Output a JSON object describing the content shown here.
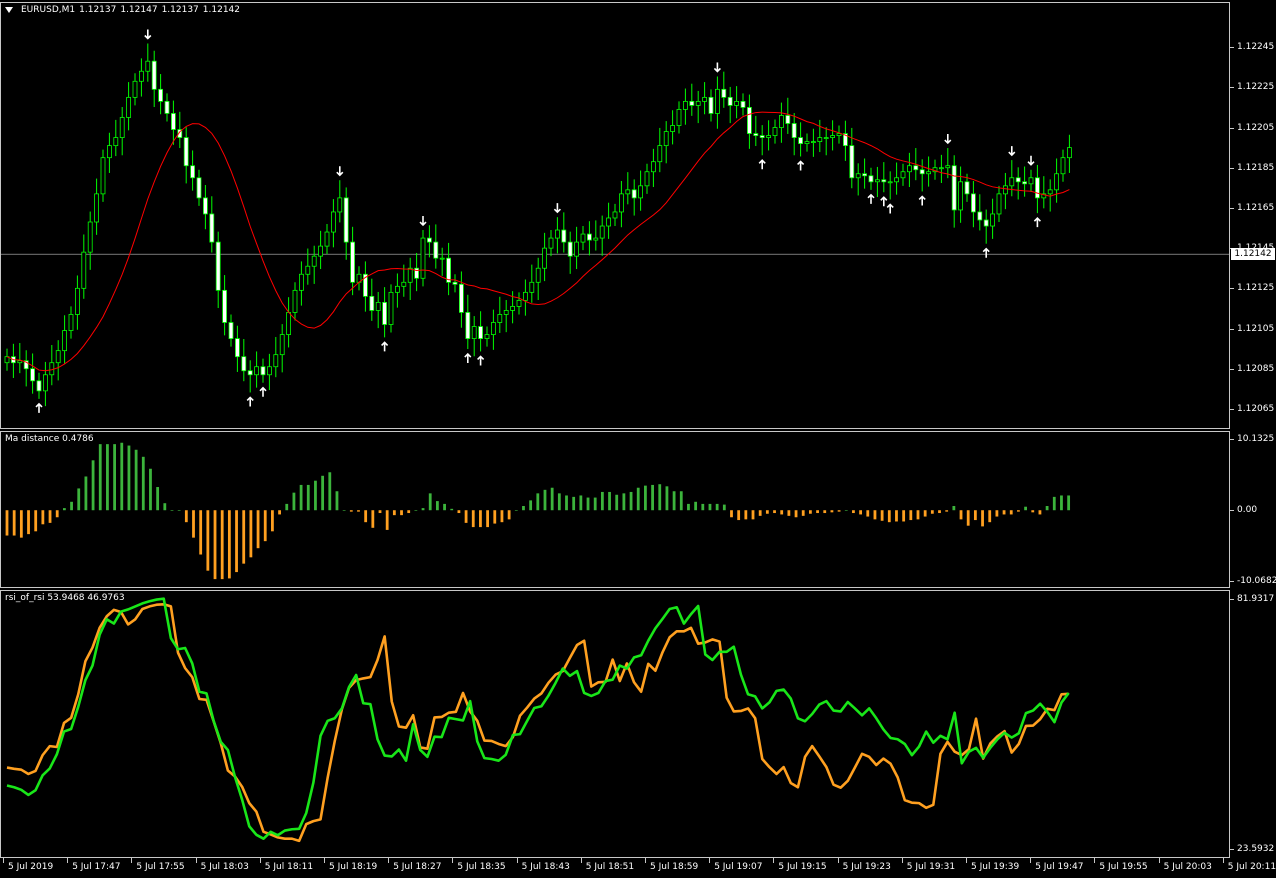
{
  "main": {
    "symbol": "EURUSD,M1",
    "ohlc": [
      "1.12137",
      "1.12147",
      "1.12137",
      "1.12142"
    ],
    "current_price": "1.12142",
    "y_ticks": [
      "1.12245",
      "1.12225",
      "1.12205",
      "1.12185",
      "1.12165",
      "1.12145",
      "1.12125",
      "1.12105",
      "1.12085",
      "1.12065"
    ],
    "colors": {
      "bull_candle": "#000000",
      "bear_candle": "#ffffff",
      "wick": "#00ff00",
      "moving_average": "#ff0000",
      "arrow": "#ffffff",
      "price_line": "#c0c0c0"
    }
  },
  "ma_panel": {
    "title": "Ma distance 0.4786",
    "y_ticks": [
      "10.1325",
      "0.00",
      "-10.0682"
    ],
    "colors": {
      "positive": "#3cb43c",
      "negative": "#ffa020"
    }
  },
  "rsi_panel": {
    "title": "rsi_of_rsi 53.9468 46.9763",
    "y_ticks": [
      "81.9317",
      "23.5932"
    ],
    "colors": {
      "line_green": "#19e619",
      "line_orange": "#ffa020"
    }
  },
  "x_axis": {
    "labels": [
      "5 Jul 2019",
      "5 Jul 17:47",
      "5 Jul 17:55",
      "5 Jul 18:03",
      "5 Jul 18:11",
      "5 Jul 18:19",
      "5 Jul 18:27",
      "5 Jul 18:35",
      "5 Jul 18:43",
      "5 Jul 18:51",
      "5 Jul 18:59",
      "5 Jul 19:07",
      "5 Jul 19:15",
      "5 Jul 19:23",
      "5 Jul 19:31",
      "5 Jul 19:39",
      "5 Jul 19:47",
      "5 Jul 19:55",
      "5 Jul 20:03",
      "5 Jul 20:11"
    ]
  },
  "chart_data": [
    {
      "type": "candlestick",
      "title": "EURUSD,M1",
      "ylim": [
        1.12059,
        1.12257
      ],
      "close": [
        1.12091,
        1.12088,
        1.12089,
        1.12085,
        1.12079,
        1.12074,
        1.12082,
        1.12088,
        1.12094,
        1.12104,
        1.12112,
        1.12125,
        1.12143,
        1.12158,
        1.12172,
        1.1219,
        1.12196,
        1.122,
        1.1221,
        1.1222,
        1.12228,
        1.12233,
        1.12238,
        1.12224,
        1.12218,
        1.12212,
        1.12204,
        1.122,
        1.12186,
        1.1218,
        1.1217,
        1.12162,
        1.12148,
        1.12124,
        1.12108,
        1.121,
        1.12091,
        1.12084,
        1.12082,
        1.12086,
        1.12082,
        1.12086,
        1.12092,
        1.12102,
        1.12113,
        1.12124,
        1.12132,
        1.12136,
        1.12141,
        1.12146,
        1.12153,
        1.12163,
        1.1217,
        1.12148,
        1.12128,
        1.12132,
        1.12121,
        1.12114,
        1.12118,
        1.12107,
        1.12123,
        1.12126,
        1.12128,
        1.12135,
        1.1213,
        1.1215,
        1.12148,
        1.1214,
        1.1214,
        1.12128,
        1.12127,
        1.12113,
        1.121,
        1.12106,
        1.121,
        1.12102,
        1.12108,
        1.12112,
        1.12114,
        1.12116,
        1.12119,
        1.12123,
        1.12128,
        1.12135,
        1.12145,
        1.1215,
        1.12154,
        1.12148,
        1.12141,
        1.12148,
        1.12152,
        1.12149,
        1.1215,
        1.12156,
        1.1216,
        1.12163,
        1.12172,
        1.12174,
        1.1217,
        1.12176,
        1.12183,
        1.12188,
        1.12196,
        1.12203,
        1.12206,
        1.12214,
        1.12218,
        1.12216,
        1.12218,
        1.1222,
        1.12212,
        1.12224,
        1.1222,
        1.12216,
        1.12218,
        1.12215,
        1.12202,
        1.12201,
        1.122,
        1.12201,
        1.12205,
        1.12211,
        1.12207,
        1.122,
        1.12197,
        1.12198,
        1.12198,
        1.122,
        1.122,
        1.12201,
        1.12202,
        1.12196,
        1.1218,
        1.12182,
        1.12181,
        1.12178,
        1.12179,
        1.12178,
        1.12178,
        1.1218,
        1.12183,
        1.12186,
        1.12184,
        1.12182,
        1.12183,
        1.12185,
        1.12185,
        1.12186,
        1.12164,
        1.12178,
        1.12172,
        1.12163,
        1.12159,
        1.12156,
        1.12162,
        1.12172,
        1.12176,
        1.1218,
        1.12178,
        1.12177,
        1.1218,
        1.1217,
        1.12172,
        1.12174,
        1.12182,
        1.1219,
        1.12195
      ]
    },
    {
      "type": "bar",
      "title": "Ma distance 0.4786",
      "ylim": [
        -10.0682,
        10.1325
      ],
      "values": [
        -3.6,
        -3.6,
        -3.9,
        -3.4,
        -3.0,
        -2.0,
        -1.8,
        -1.0,
        0.3,
        1.2,
        3.1,
        4.8,
        7.1,
        9.4,
        9.4,
        9.4,
        9.6,
        9.2,
        8.6,
        7.6,
        5.9,
        3.3,
        1.0,
        0.0,
        0.0,
        -1.7,
        -3.9,
        -6.3,
        -8.6,
        -9.8,
        -9.8,
        -9.7,
        -8.8,
        -7.6,
        -6.7,
        -5.4,
        -4.4,
        -3.0,
        -0.6,
        0.9,
        2.5,
        3.6,
        3.6,
        4.2,
        4.9,
        5.4,
        2.7,
        0.0,
        -0.2,
        -0.2,
        -1.7,
        -2.5,
        -0.4,
        -2.8,
        -0.7,
        -0.7,
        -0.4,
        0.0,
        0.3,
        2.4,
        1.3,
        0.9,
        0.2,
        -0.4,
        -1.8,
        -2.4,
        -2.4,
        -2.4,
        -1.9,
        -1.7,
        -1.3,
        0.0,
        0.6,
        1.4,
        2.4,
        2.9,
        3.2,
        2.4,
        2.1,
        1.9,
        2.1,
        1.8,
        1.8,
        2.6,
        2.6,
        2.2,
        2.4,
        2.6,
        3.2,
        3.5,
        3.6,
        3.7,
        3.4,
        2.7,
        2.7,
        0.9,
        1.2,
        0.9,
        0.9,
        0.9,
        0.8,
        -1.0,
        -1.4,
        -1.3,
        -1.3,
        -0.8,
        -0.5,
        -0.4,
        -0.6,
        -0.8,
        -1.0,
        -0.8,
        -0.5,
        -0.4,
        -0.4,
        -0.3,
        -0.2,
        0.0,
        -0.4,
        -0.6,
        -0.9,
        -1.3,
        -1.5,
        -1.7,
        -1.6,
        -1.6,
        -1.4,
        -1.3,
        -0.9,
        -0.5,
        -0.4,
        -0.2,
        0.6,
        -1.3,
        -2.2,
        -1.4,
        -2.3,
        -1.7,
        -0.9,
        -0.6,
        -0.6,
        -0.2,
        0.5,
        -0.3,
        -0.6,
        0.6,
        1.9,
        2.1,
        2.1
      ]
    },
    {
      "type": "line",
      "title": "rsi_of_rsi 53.9468 46.9763",
      "ylim": [
        23.5932,
        81.9317
      ],
      "series": [
        {
          "values": [
            42.6,
            42.3,
            42.1,
            41.1,
            41.8,
            45.5,
            47.6,
            47.4,
            53.0,
            54.2,
            59.7,
            67.4,
            70.6,
            75.2,
            77.9,
            79.4,
            78.9,
            76.0,
            77.2,
            79.6,
            80.2,
            80.6,
            80.7,
            80.2,
            69.4,
            65.8,
            63.7,
            58.6,
            58.4,
            53.4,
            48.3,
            41.9,
            40.5,
            38.1,
            34.3,
            32.3,
            27.6,
            27.0,
            26.3,
            26.0,
            26.0,
            25.5,
            29.4,
            30.1,
            30.5,
            40.2,
            48.8,
            56.2,
            61.2,
            63.0,
            63.4,
            63.7,
            67.7,
            73.2,
            58.0,
            52.2,
            51.9,
            54.8,
            47.3,
            47.0,
            54.3,
            54.4,
            55.4,
            55.6,
            60.0,
            55.7,
            53.5,
            48.9,
            48.8,
            48.1,
            47.6,
            49.7,
            54.7,
            56.6,
            58.7,
            59.9,
            62.4,
            64.3,
            65.1,
            68.2,
            71.2,
            72.2,
            61.5,
            62.5,
            62.6,
            67.8,
            62.8,
            66.9,
            62.5,
            60.3,
            66.8,
            65.2,
            69.5,
            73.0,
            74.4,
            74.4,
            75.2,
            71.5,
            71.8,
            72.5,
            72.0,
            58.9,
            55.7,
            55.8,
            56.4,
            54.1,
            44.6,
            42.7,
            41.1,
            42.7,
            39.0,
            38.0,
            45.1,
            47.6,
            45.2,
            42.7,
            38.6,
            37.9,
            39.5,
            42.6,
            45.8,
            45.1,
            43.2,
            44.7,
            43.5,
            40.3,
            35.0,
            34.4,
            34.3,
            33.2,
            33.9,
            45.8,
            48.6,
            46.3,
            45.5,
            46.9,
            54.0,
            44.7,
            48.2,
            49.9,
            51.1,
            46.1,
            48.1,
            52.3,
            52.4,
            53.9,
            56.3,
            56.0,
            59.7,
            59.8
          ]
        },
        {
          "values": [
            38.4,
            38.0,
            37.4,
            36.2,
            37.3,
            40.8,
            42.4,
            45.7,
            51.0,
            51.6,
            56.8,
            63.0,
            66.4,
            73.6,
            77.2,
            76.2,
            79.0,
            79.5,
            80.2,
            80.9,
            81.4,
            81.8,
            82.0,
            72.8,
            70.2,
            70.5,
            66.9,
            60.3,
            59.9,
            53.5,
            48.6,
            46.7,
            40.4,
            35.1,
            28.9,
            26.9,
            26.0,
            27.6,
            26.8,
            27.9,
            28.2,
            28.3,
            32.0,
            39.1,
            50.0,
            53.5,
            54.1,
            56.4,
            61.4,
            64.2,
            57.6,
            57.4,
            49.2,
            45.4,
            45.2,
            46.8,
            44.2,
            52.7,
            46.7,
            45.1,
            49.8,
            49.7,
            54.2,
            53.9,
            53.6,
            58.1,
            48.7,
            44.8,
            44.6,
            44.2,
            45.6,
            50.2,
            50.4,
            53.5,
            56.5,
            56.9,
            59.4,
            62.4,
            65.7,
            64.0,
            65.1,
            60.0,
            59.3,
            60.0,
            62.8,
            63.1,
            66.4,
            65.7,
            68.3,
            68.8,
            72.2,
            75.1,
            77.3,
            79.6,
            80.0,
            76.2,
            78.4,
            80.3,
            69.0,
            67.7,
            69.6,
            69.6,
            70.8,
            64.3,
            59.7,
            59.2,
            56.4,
            57.8,
            60.5,
            60.8,
            58.7,
            54.1,
            53.4,
            55.1,
            57.3,
            58.1,
            55.9,
            55.7,
            57.9,
            56.4,
            54.8,
            56.4,
            54.1,
            51.5,
            49.5,
            49.2,
            48.1,
            45.5,
            47.5,
            51.0,
            48.4,
            50.0,
            49.2,
            55.4,
            43.6,
            46.3,
            47.2,
            44.9,
            47.2,
            49.2,
            50.7,
            49.6,
            50.6,
            55.3,
            55.9,
            57.5,
            55.6,
            53.2,
            57.8,
            60.0
          ]
        }
      ]
    }
  ]
}
